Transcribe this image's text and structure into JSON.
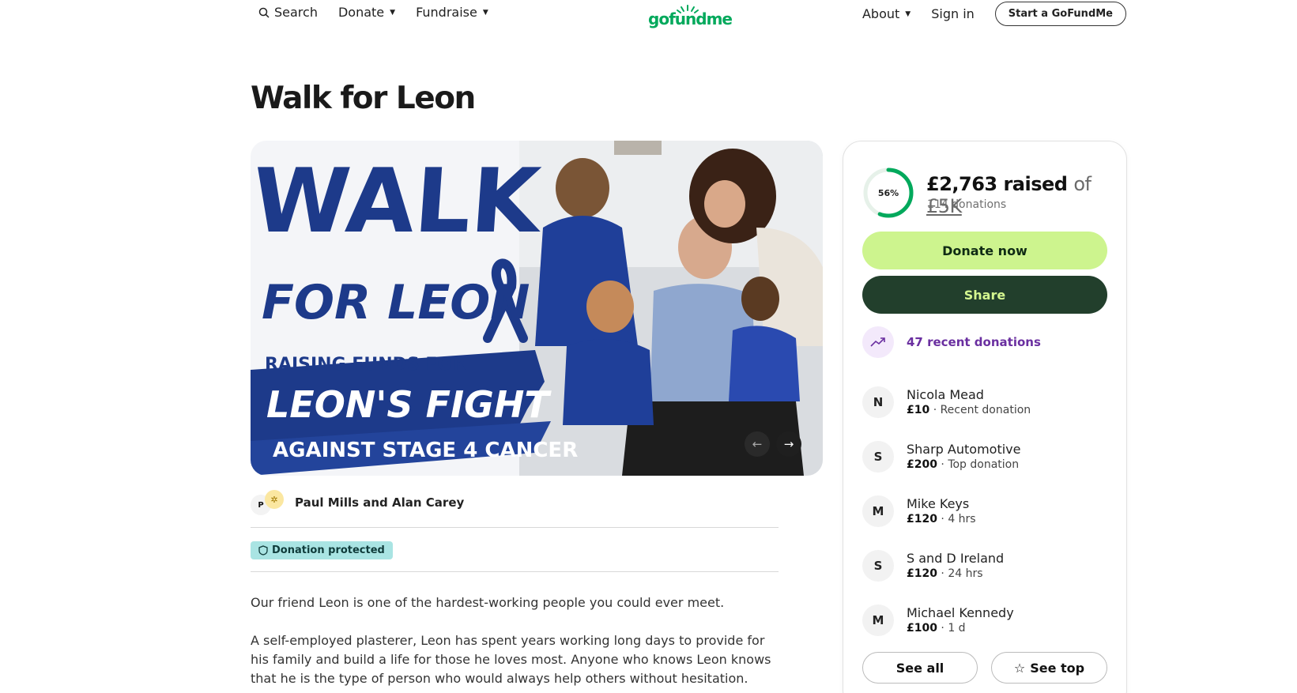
{
  "nav": {
    "search_label": "Search",
    "donate_label": "Donate",
    "fundraise_label": "Fundraise",
    "about_label": "About",
    "signin_label": "Sign in",
    "start_label": "Start a GoFundMe",
    "logo_text": "gofundme"
  },
  "campaign": {
    "title": "Walk for Leon",
    "hero_text_1": "WALK",
    "hero_text_2": "FOR LEON",
    "hero_text_3": "RAISING FUNDS FOR",
    "hero_text_4": "LEON'S FIGHT",
    "hero_text_5": "AGAINST STAGE 4 CANCER",
    "organizer_initial": "P",
    "organizer_name": "Paul Mills and Alan Carey",
    "protected_label": "Donation protected",
    "description": [
      "Our friend Leon is one of the hardest-working people you could ever meet.",
      "A self-employed plasterer, Leon has spent years working long days to provide for his family and build a life for those he loves most. Anyone who knows Leon knows that he is the type of person who would always help others without hesitation."
    ]
  },
  "progress": {
    "percent_label": "56%",
    "fraction": 0.56,
    "raised": "£2,763 raised",
    "of": "of",
    "goal": "£5K",
    "donations": "114 donations"
  },
  "actions": {
    "donate": "Donate now",
    "share": "Share",
    "recent": "47 recent donations",
    "see_all": "See all",
    "see_top": "See top"
  },
  "donors": [
    {
      "initial": "N",
      "name": "Nicola Mead",
      "amount": "£10",
      "note": "· Recent donation"
    },
    {
      "initial": "S",
      "name": "Sharp Automotive",
      "amount": "£200",
      "note": "· Top donation"
    },
    {
      "initial": "M",
      "name": "Mike Keys",
      "amount": "£120",
      "note": "· 4 hrs"
    },
    {
      "initial": "S",
      "name": "S and D Ireland",
      "amount": "£120",
      "note": "· 24 hrs"
    },
    {
      "initial": "M",
      "name": "Michael Kennedy",
      "amount": "£100",
      "note": "· 1 d"
    }
  ],
  "colors": {
    "brand_green": "#02a95c",
    "donate_button": "#cdf48e",
    "share_button": "#223f2c",
    "protected_badge": "#a9e4e3",
    "recent_purple": "#6a2fa0",
    "hero_navy": "#1d3a8a"
  }
}
